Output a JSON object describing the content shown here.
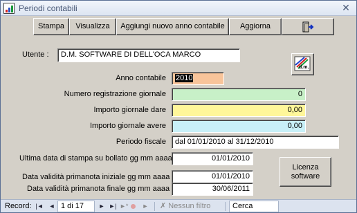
{
  "window": {
    "title": "Periodi contabili",
    "close_glyph": "✕",
    "app_icon": "chart-app-icon"
  },
  "toolbar": {
    "stampa": "Stampa",
    "visualizza": "Visualizza",
    "aggiungi": "Aggiungi nuovo anno contabile",
    "aggiorna": "Aggiorna",
    "exit_icon": "exit-door-icon"
  },
  "form": {
    "utente_label": "Utente :",
    "utente_value": "D.M. SOFTWARE DI DELL'OCA MARCO",
    "anno_label": "Anno contabile",
    "anno_value": "2010",
    "numero_label": "Numero registrazione giornale",
    "numero_value": "0",
    "dare_label": "Importo giornale dare",
    "dare_value": "0,00",
    "avere_label": "Importo giornale avere",
    "avere_value": "0,00",
    "periodo_label": "Periodo fiscale",
    "periodo_value": "dal 01/01/2010 al 31/12/2010",
    "ultima_label": "Ultima data di stampa su bollato gg mm aaaa",
    "ultima_value": "01/01/2010",
    "iniziale_label": "Data validità primanota iniziale gg mm aaaa",
    "iniziale_value": "01/01/2010",
    "finale_label": "Data validità primanota finale gg mm aaaa",
    "finale_value": "30/06/2011",
    "licenza_line1": "Licenza",
    "licenza_line2": "software",
    "dm_icon_label": "d.m."
  },
  "colors": {
    "anno_bg": "#f8c49a",
    "numero_bg": "#c8f0c8",
    "dare_bg": "#fff79a",
    "avere_bg": "#c8f0f8"
  },
  "navbar": {
    "record_label": "Record:",
    "first": "|◄",
    "prev": "◄",
    "position": "1 di 17",
    "next": "►",
    "last": "►|",
    "new": "►*",
    "filter_label": "Nessun filtro",
    "search_placeholder": "Cerca"
  }
}
